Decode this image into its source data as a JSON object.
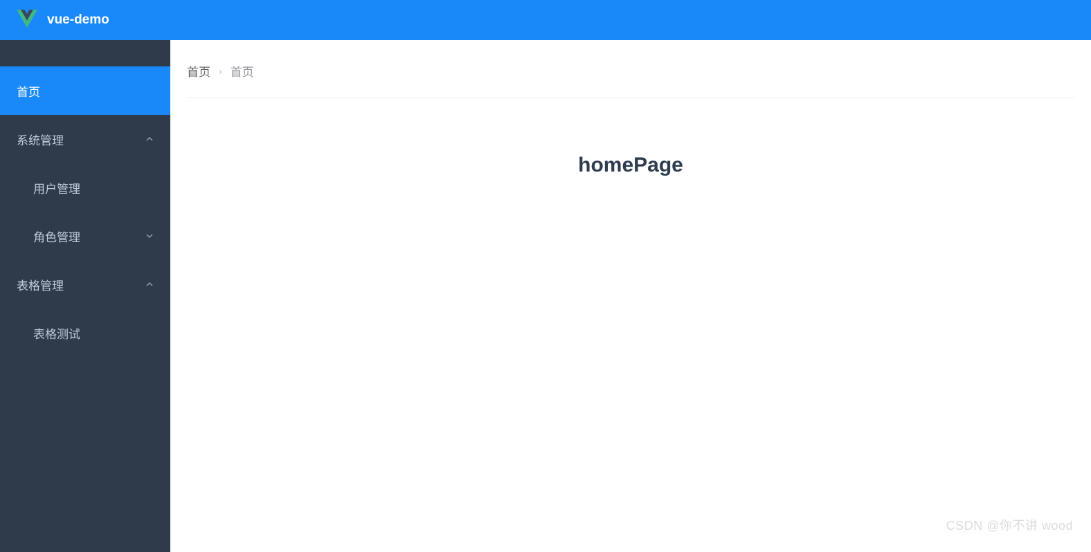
{
  "header": {
    "app_title": "vue-demo"
  },
  "sidebar": {
    "items": [
      {
        "label": "首页",
        "active": true,
        "expand": null
      },
      {
        "label": "系统管理",
        "active": false,
        "expand": "up"
      },
      {
        "label": "用户管理",
        "active": false,
        "expand": null,
        "sub": true
      },
      {
        "label": "角色管理",
        "active": false,
        "expand": "down",
        "sub": true
      },
      {
        "label": "表格管理",
        "active": false,
        "expand": "up"
      },
      {
        "label": "表格测试",
        "active": false,
        "expand": null,
        "sub": true
      }
    ]
  },
  "breadcrumb": {
    "items": [
      "首页",
      "首页"
    ],
    "separator": "›"
  },
  "main": {
    "heading": "homePage"
  },
  "watermark": "CSDN @你不讲 wood"
}
